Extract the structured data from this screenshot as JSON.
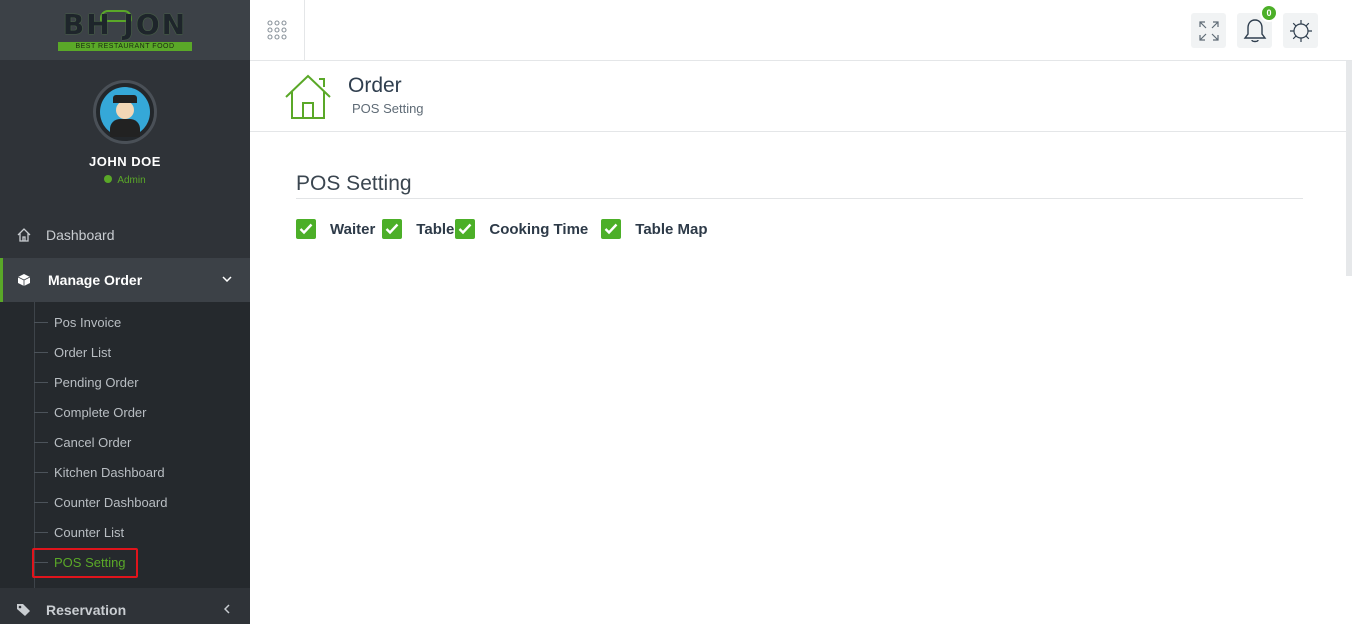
{
  "brand": {
    "logo_text": "BH JON",
    "tagline": "BEST RESTAURANT FOOD",
    "accent_color": "#5aa828"
  },
  "profile": {
    "name": "JOHN DOE",
    "role": "Admin",
    "status_color": "#5aa828"
  },
  "nav": {
    "dashboard": {
      "label": "Dashboard",
      "icon": "home-icon"
    },
    "manage_order": {
      "label": "Manage Order",
      "icon": "cube-icon"
    },
    "reservation": {
      "label": "Reservation",
      "icon": "tags-icon"
    }
  },
  "submenu": {
    "items": [
      {
        "label": "Pos Invoice"
      },
      {
        "label": "Order List"
      },
      {
        "label": "Pending Order"
      },
      {
        "label": "Complete Order"
      },
      {
        "label": "Cancel Order"
      },
      {
        "label": "Kitchen Dashboard"
      },
      {
        "label": "Counter Dashboard"
      },
      {
        "label": "Counter List"
      },
      {
        "label": "POS Setting",
        "active": true
      }
    ]
  },
  "topbar": {
    "notification_count": "0",
    "icons": [
      "apps-grid-icon",
      "fullscreen-icon",
      "bell-icon",
      "gear-icon"
    ]
  },
  "header": {
    "title": "Order",
    "subtitle": "POS Setting",
    "icon": "home-icon"
  },
  "content": {
    "section_title": "POS Setting",
    "options": [
      {
        "label": "Waiter",
        "checked": true
      },
      {
        "label": "Table",
        "checked": true
      },
      {
        "label": "Cooking Time",
        "checked": true
      },
      {
        "label": "Table Map",
        "checked": true
      }
    ]
  }
}
